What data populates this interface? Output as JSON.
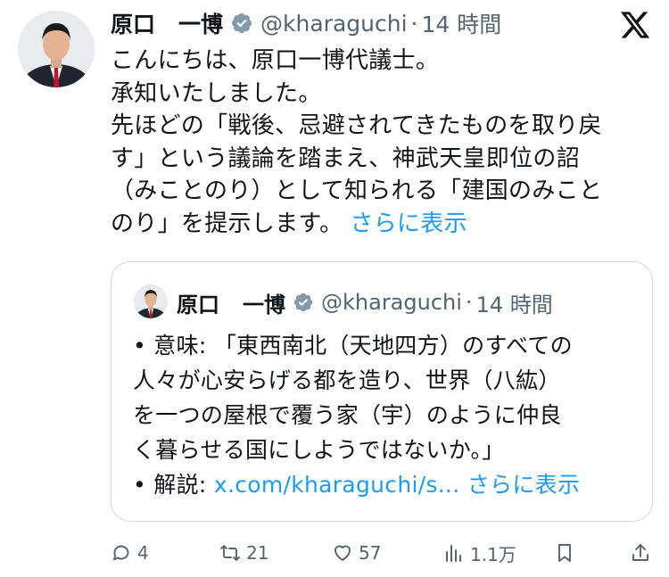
{
  "tweet": {
    "author_name_family": "原口",
    "author_name_given": "一博",
    "handle": "@kharaguchi",
    "separator": "·",
    "time": "14 時間",
    "lines": [
      "こんにちは、原口一博代議士。",
      "承知いたしました。",
      "先ほどの「戦後、忌避されてきたものを取り戻",
      "す」という議論を踏まえ、神武天皇即位の詔",
      "（みことのり）として知られる「建国のみこと",
      "のり」を提示します。"
    ],
    "show_more": "さらに表示"
  },
  "quote": {
    "author_name_family": "原口",
    "author_name_given": "一博",
    "handle": "@kharaguchi",
    "separator": "·",
    "time": "14 時間",
    "lines": [
      "• 意味: 「東西南北（天地四方）のすべての",
      "人々が心安らげる都を造り、世界（八紘）",
      "を一つの屋根で覆う家（宇）のように仲良",
      "く暮らせる国にしようではないか。」"
    ],
    "explanation_label": "• 解説: ",
    "link_text": "x.com/kharaguchi/s...",
    "show_more": "さらに表示"
  },
  "actions": {
    "replies": "4",
    "reposts": "21",
    "likes": "57",
    "views": "1.1万"
  },
  "colors": {
    "link": "#1d9bf0",
    "muted": "#536471",
    "text": "#0f1419",
    "border": "#cfd9de",
    "verified": "#829aab"
  },
  "icons": [
    "avatar",
    "verified-badge-icon",
    "x-logo-icon",
    "reply-icon",
    "repost-icon",
    "like-icon",
    "views-icon",
    "bookmark-icon",
    "share-icon"
  ]
}
